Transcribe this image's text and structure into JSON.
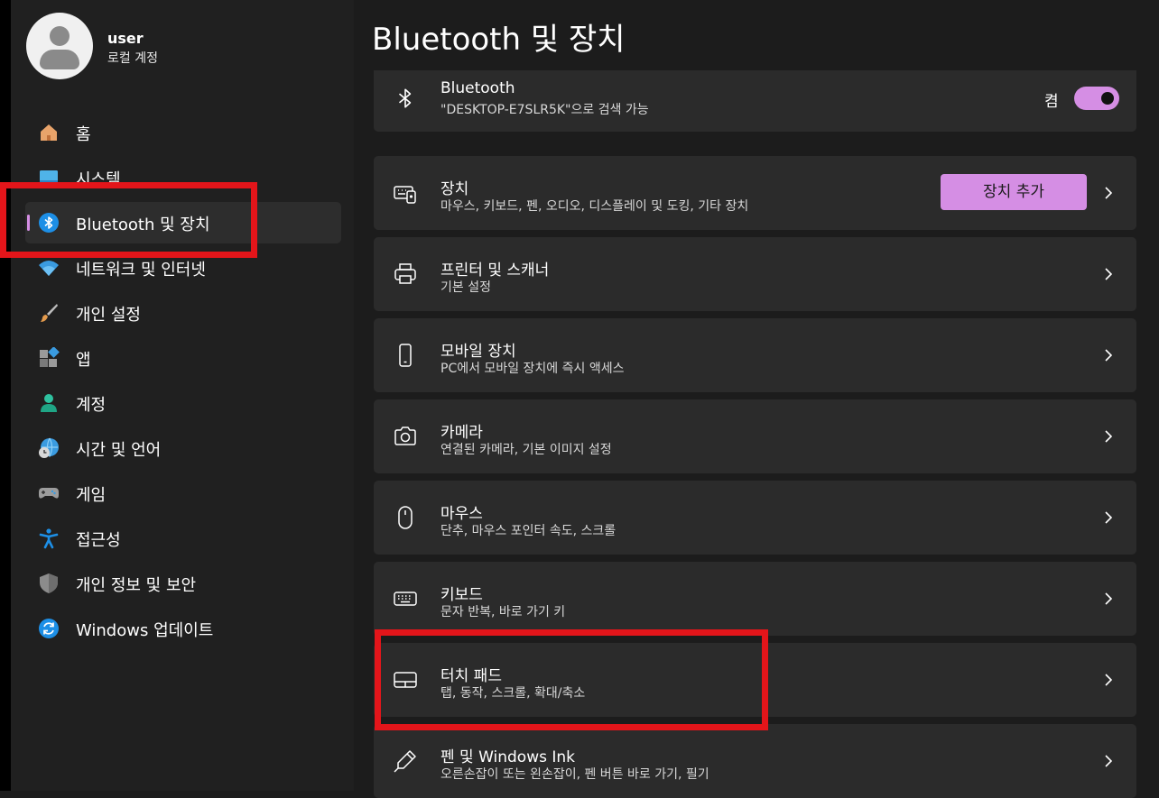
{
  "user": {
    "name": "user",
    "account_type": "로컬 계정"
  },
  "nav": [
    {
      "label": "홈",
      "icon": "home-icon",
      "selected": false
    },
    {
      "label": "시스템",
      "icon": "system-icon",
      "selected": false
    },
    {
      "label": "Bluetooth 및 장치",
      "icon": "bluetooth-icon",
      "selected": true
    },
    {
      "label": "네트워크 및 인터넷",
      "icon": "wifi-icon",
      "selected": false
    },
    {
      "label": "개인 설정",
      "icon": "brush-icon",
      "selected": false
    },
    {
      "label": "앱",
      "icon": "apps-icon",
      "selected": false
    },
    {
      "label": "계정",
      "icon": "account-icon",
      "selected": false
    },
    {
      "label": "시간 및 언어",
      "icon": "globe-clock-icon",
      "selected": false
    },
    {
      "label": "게임",
      "icon": "gamepad-icon",
      "selected": false
    },
    {
      "label": "접근성",
      "icon": "accessibility-icon",
      "selected": false
    },
    {
      "label": "개인 정보 및 보안",
      "icon": "shield-icon",
      "selected": false
    },
    {
      "label": "Windows 업데이트",
      "icon": "update-icon",
      "selected": false
    }
  ],
  "page": {
    "title": "Bluetooth 및 장치"
  },
  "bluetooth_card": {
    "title": "Bluetooth",
    "subtitle": "\"DESKTOP-E7SLR5K\"으로 검색 가능",
    "toggle_label": "켬",
    "toggle_on": true
  },
  "cards": [
    {
      "title": "장치",
      "subtitle": "마우스, 키보드, 펜, 오디오, 디스플레이 및 도킹, 기타 장치",
      "icon": "devices-icon",
      "button": "장치 추가"
    },
    {
      "title": "프린터 및 스캐너",
      "subtitle": "기본 설정",
      "icon": "printer-icon"
    },
    {
      "title": "모바일 장치",
      "subtitle": "PC에서 모바일 장치에 즉시 액세스",
      "icon": "phone-icon"
    },
    {
      "title": "카메라",
      "subtitle": "연결된 카메라, 기본 이미지 설정",
      "icon": "camera-icon"
    },
    {
      "title": "마우스",
      "subtitle": "단추, 마우스 포인터 속도, 스크롤",
      "icon": "mouse-icon"
    },
    {
      "title": "키보드",
      "subtitle": "문자 반복, 바로 가기 키",
      "icon": "keyboard-icon"
    },
    {
      "title": "터치 패드",
      "subtitle": "탭, 동작, 스크롤, 확대/축소",
      "icon": "touchpad-icon"
    },
    {
      "title": "펜 및 Windows Ink",
      "subtitle": "오른손잡이 또는 왼손잡이, 펜 버튼 바로 가기, 필기",
      "icon": "pen-icon"
    }
  ],
  "colors": {
    "accent": "#d58ee4",
    "highlight": "#e3151a",
    "card": "#2b2b2b",
    "sidebar": "#202020"
  }
}
